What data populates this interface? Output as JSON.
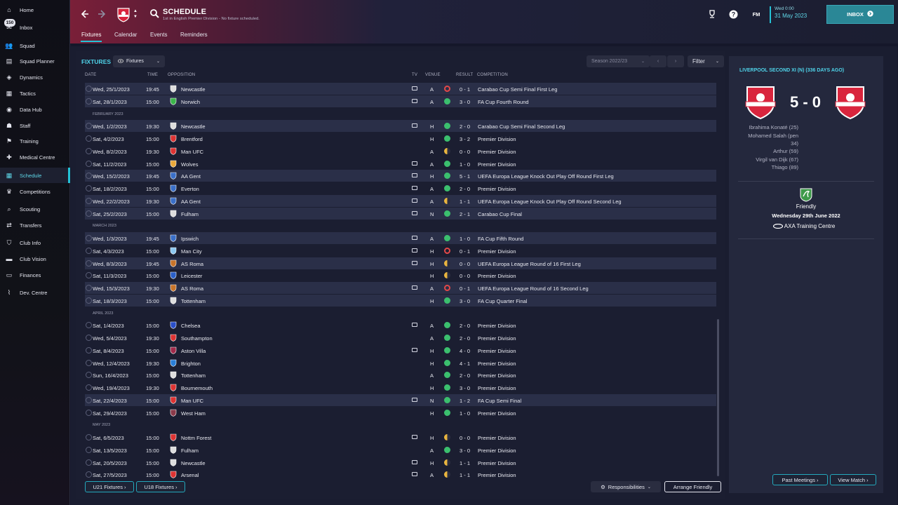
{
  "sidebar": {
    "items": [
      {
        "label": "Home",
        "icon": "home-icon"
      },
      {
        "label": "Inbox",
        "icon": "inbox-icon",
        "badge": "150"
      },
      {
        "label": "Squad",
        "icon": "squad-icon"
      },
      {
        "label": "Squad Planner",
        "icon": "squad-planner-icon"
      },
      {
        "label": "Dynamics",
        "icon": "dynamics-icon"
      },
      {
        "label": "Tactics",
        "icon": "tactics-icon"
      },
      {
        "label": "Data Hub",
        "icon": "data-hub-icon"
      },
      {
        "label": "Staff",
        "icon": "staff-icon"
      },
      {
        "label": "Training",
        "icon": "training-icon"
      },
      {
        "label": "Medical Centre",
        "icon": "medical-icon"
      },
      {
        "label": "Schedule",
        "icon": "schedule-icon",
        "active": true
      },
      {
        "label": "Competitions",
        "icon": "trophy-icon"
      },
      {
        "label": "Scouting",
        "icon": "scouting-icon"
      },
      {
        "label": "Transfers",
        "icon": "transfers-icon"
      },
      {
        "label": "Club Info",
        "icon": "club-info-icon"
      },
      {
        "label": "Club Vision",
        "icon": "club-vision-icon"
      },
      {
        "label": "Finances",
        "icon": "finances-icon"
      },
      {
        "label": "Dev. Centre",
        "icon": "dev-centre-icon"
      }
    ]
  },
  "header": {
    "title": "SCHEDULE",
    "subtitle": "1st in English Premier Division - No fixture scheduled.",
    "tabs": [
      "Fixtures",
      "Calendar",
      "Events",
      "Reminders"
    ],
    "date_line1": "Wed 0:00",
    "date_line2": "31 May 2023",
    "inbox_label": "INBOX",
    "fm_label": "FM"
  },
  "fixtures": {
    "title": "FIXTURES",
    "view_dropdown": "Fixtures",
    "season": "Season 2022/23",
    "filter": "Filter",
    "columns": {
      "date": "DATE",
      "time": "TIME",
      "opposition": "OPPOSITION",
      "tv": "TV",
      "venue": "VENUE",
      "result": "RESULT",
      "competition": "COMPETITION"
    },
    "rows": [
      {
        "date": "Wed, 25/1/2023",
        "time": "19:45",
        "opp": "Newcastle",
        "tv": true,
        "venue": "A",
        "res": "loss",
        "score": "0 - 1",
        "comp": "Carabao Cup Semi Final First Leg",
        "hl": true
      },
      {
        "date": "Sat, 28/1/2023",
        "time": "15:00",
        "opp": "Norwich",
        "tv": true,
        "venue": "A",
        "res": "win",
        "score": "3 - 0",
        "comp": "FA Cup Fourth Round",
        "hl": true
      },
      {
        "section": "FEBRUARY 2023"
      },
      {
        "date": "Wed, 1/2/2023",
        "time": "19:30",
        "opp": "Newcastle",
        "tv": true,
        "venue": "H",
        "res": "win",
        "score": "2 - 0",
        "comp": "Carabao Cup Semi Final Second Leg",
        "hl": true
      },
      {
        "date": "Sat, 4/2/2023",
        "time": "15:00",
        "opp": "Brentford",
        "tv": false,
        "venue": "H",
        "res": "win",
        "score": "3 - 2",
        "comp": "Premier Division"
      },
      {
        "date": "Wed, 8/2/2023",
        "time": "19:30",
        "opp": "Man UFC",
        "tv": false,
        "venue": "A",
        "res": "draw",
        "score": "0 - 0",
        "comp": "Premier Division"
      },
      {
        "date": "Sat, 11/2/2023",
        "time": "15:00",
        "opp": "Wolves",
        "tv": true,
        "venue": "A",
        "res": "win",
        "score": "1 - 0",
        "comp": "Premier Division"
      },
      {
        "date": "Wed, 15/2/2023",
        "time": "19:45",
        "opp": "AA Gent",
        "tv": true,
        "venue": "H",
        "res": "win",
        "score": "5 - 1",
        "comp": "UEFA Europa League Knock Out Play Off Round First Leg",
        "hl": true
      },
      {
        "date": "Sat, 18/2/2023",
        "time": "15:00",
        "opp": "Everton",
        "tv": true,
        "venue": "A",
        "res": "win",
        "score": "2 - 0",
        "comp": "Premier Division"
      },
      {
        "date": "Wed, 22/2/2023",
        "time": "19:30",
        "opp": "AA Gent",
        "tv": true,
        "venue": "A",
        "res": "draw",
        "score": "1 - 1",
        "comp": "UEFA Europa League Knock Out Play Off Round Second Leg",
        "hl": true
      },
      {
        "date": "Sat, 25/2/2023",
        "time": "15:00",
        "opp": "Fulham",
        "tv": true,
        "venue": "N",
        "res": "win",
        "score": "2 - 1",
        "comp": "Carabao Cup Final",
        "hl": true
      },
      {
        "section": "MARCH 2023"
      },
      {
        "date": "Wed, 1/3/2023",
        "time": "19:45",
        "opp": "Ipswich",
        "tv": true,
        "venue": "A",
        "res": "win",
        "score": "1 - 0",
        "comp": "FA Cup Fifth Round",
        "hl": true
      },
      {
        "date": "Sat, 4/3/2023",
        "time": "15:00",
        "opp": "Man City",
        "tv": true,
        "venue": "H",
        "res": "loss",
        "score": "0 - 1",
        "comp": "Premier Division"
      },
      {
        "date": "Wed, 8/3/2023",
        "time": "19:45",
        "opp": "AS Roma",
        "tv": true,
        "venue": "H",
        "res": "draw",
        "score": "0 - 0",
        "comp": "UEFA Europa League Round of 16  First Leg",
        "hl": true
      },
      {
        "date": "Sat, 11/3/2023",
        "time": "15:00",
        "opp": "Leicester",
        "tv": false,
        "venue": "H",
        "res": "draw",
        "score": "0 - 0",
        "comp": "Premier Division"
      },
      {
        "date": "Wed, 15/3/2023",
        "time": "19:30",
        "opp": "AS Roma",
        "tv": true,
        "venue": "A",
        "res": "loss",
        "score": "0 - 1",
        "comp": "UEFA Europa League Round of 16  Second Leg",
        "hl": true
      },
      {
        "date": "Sat, 18/3/2023",
        "time": "15:00",
        "opp": "Tottenham",
        "tv": false,
        "venue": "H",
        "res": "win",
        "score": "3 - 0",
        "comp": "FA Cup Quarter Final",
        "hl": true
      },
      {
        "section": "APRIL 2023"
      },
      {
        "date": "Sat, 1/4/2023",
        "time": "15:00",
        "opp": "Chelsea",
        "tv": true,
        "venue": "A",
        "res": "win",
        "score": "2 - 0",
        "comp": "Premier Division"
      },
      {
        "date": "Wed, 5/4/2023",
        "time": "19:30",
        "opp": "Southampton",
        "tv": false,
        "venue": "A",
        "res": "win",
        "score": "2 - 0",
        "comp": "Premier Division"
      },
      {
        "date": "Sat, 8/4/2023",
        "time": "15:00",
        "opp": "Aston Villa",
        "tv": true,
        "venue": "H",
        "res": "win",
        "score": "4 - 0",
        "comp": "Premier Division"
      },
      {
        "date": "Wed, 12/4/2023",
        "time": "19:30",
        "opp": "Brighton",
        "tv": false,
        "venue": "H",
        "res": "win",
        "score": "4 - 1",
        "comp": "Premier Division"
      },
      {
        "date": "Sun, 16/4/2023",
        "time": "15:00",
        "opp": "Tottenham",
        "tv": false,
        "venue": "A",
        "res": "win",
        "score": "2 - 0",
        "comp": "Premier Division"
      },
      {
        "date": "Wed, 19/4/2023",
        "time": "19:30",
        "opp": "Bournemouth",
        "tv": false,
        "venue": "H",
        "res": "win",
        "score": "3 - 0",
        "comp": "Premier Division"
      },
      {
        "date": "Sat, 22/4/2023",
        "time": "15:00",
        "opp": "Man UFC",
        "tv": true,
        "venue": "N",
        "res": "win",
        "score": "1 - 2",
        "comp": "FA Cup Semi Final",
        "hl": true
      },
      {
        "date": "Sat, 29/4/2023",
        "time": "15:00",
        "opp": "West Ham",
        "tv": false,
        "venue": "H",
        "res": "win",
        "score": "1 - 0",
        "comp": "Premier Division"
      },
      {
        "section": "MAY 2023"
      },
      {
        "date": "Sat, 6/5/2023",
        "time": "15:00",
        "opp": "Nottm Forest",
        "tv": true,
        "venue": "H",
        "res": "draw",
        "score": "0 - 0",
        "comp": "Premier Division"
      },
      {
        "date": "Sat, 13/5/2023",
        "time": "15:00",
        "opp": "Fulham",
        "tv": false,
        "venue": "A",
        "res": "win",
        "score": "3 - 0",
        "comp": "Premier Division"
      },
      {
        "date": "Sat, 20/5/2023",
        "time": "15:00",
        "opp": "Newcastle",
        "tv": true,
        "venue": "H",
        "res": "draw",
        "score": "1 - 1",
        "comp": "Premier Division"
      },
      {
        "date": "Sat, 27/5/2023",
        "time": "15:00",
        "opp": "Arsenal",
        "tv": true,
        "venue": "A",
        "res": "draw",
        "score": "1 - 1",
        "comp": "Premier Division"
      }
    ]
  },
  "buttons": {
    "u21": "U21 Fixtures",
    "u18": "U18 Fixtures",
    "responsibilities": "Responsibilities",
    "arrange": "Arrange Friendly",
    "past": "Past Meetings",
    "view": "View Match"
  },
  "last_match": {
    "title": "LIVERPOOL SECOND XI (N) (336 DAYS AGO)",
    "score": "5 - 0",
    "scorers": [
      "Ibrahima Konaté (25)",
      "Mohamed Salah (pen",
      "34)",
      "Arthur (59)",
      "Virgil van Dijk (67)",
      "Thiago (89)"
    ],
    "competition": "Friendly",
    "date": "Wednesday 29th June 2022",
    "venue": "AXA Training Centre"
  },
  "colors": {
    "accent": "#24c2d6",
    "win": "#3bbf6e",
    "draw": "#e9b53f",
    "loss": "#e24848",
    "club_red": "#d9253d"
  }
}
